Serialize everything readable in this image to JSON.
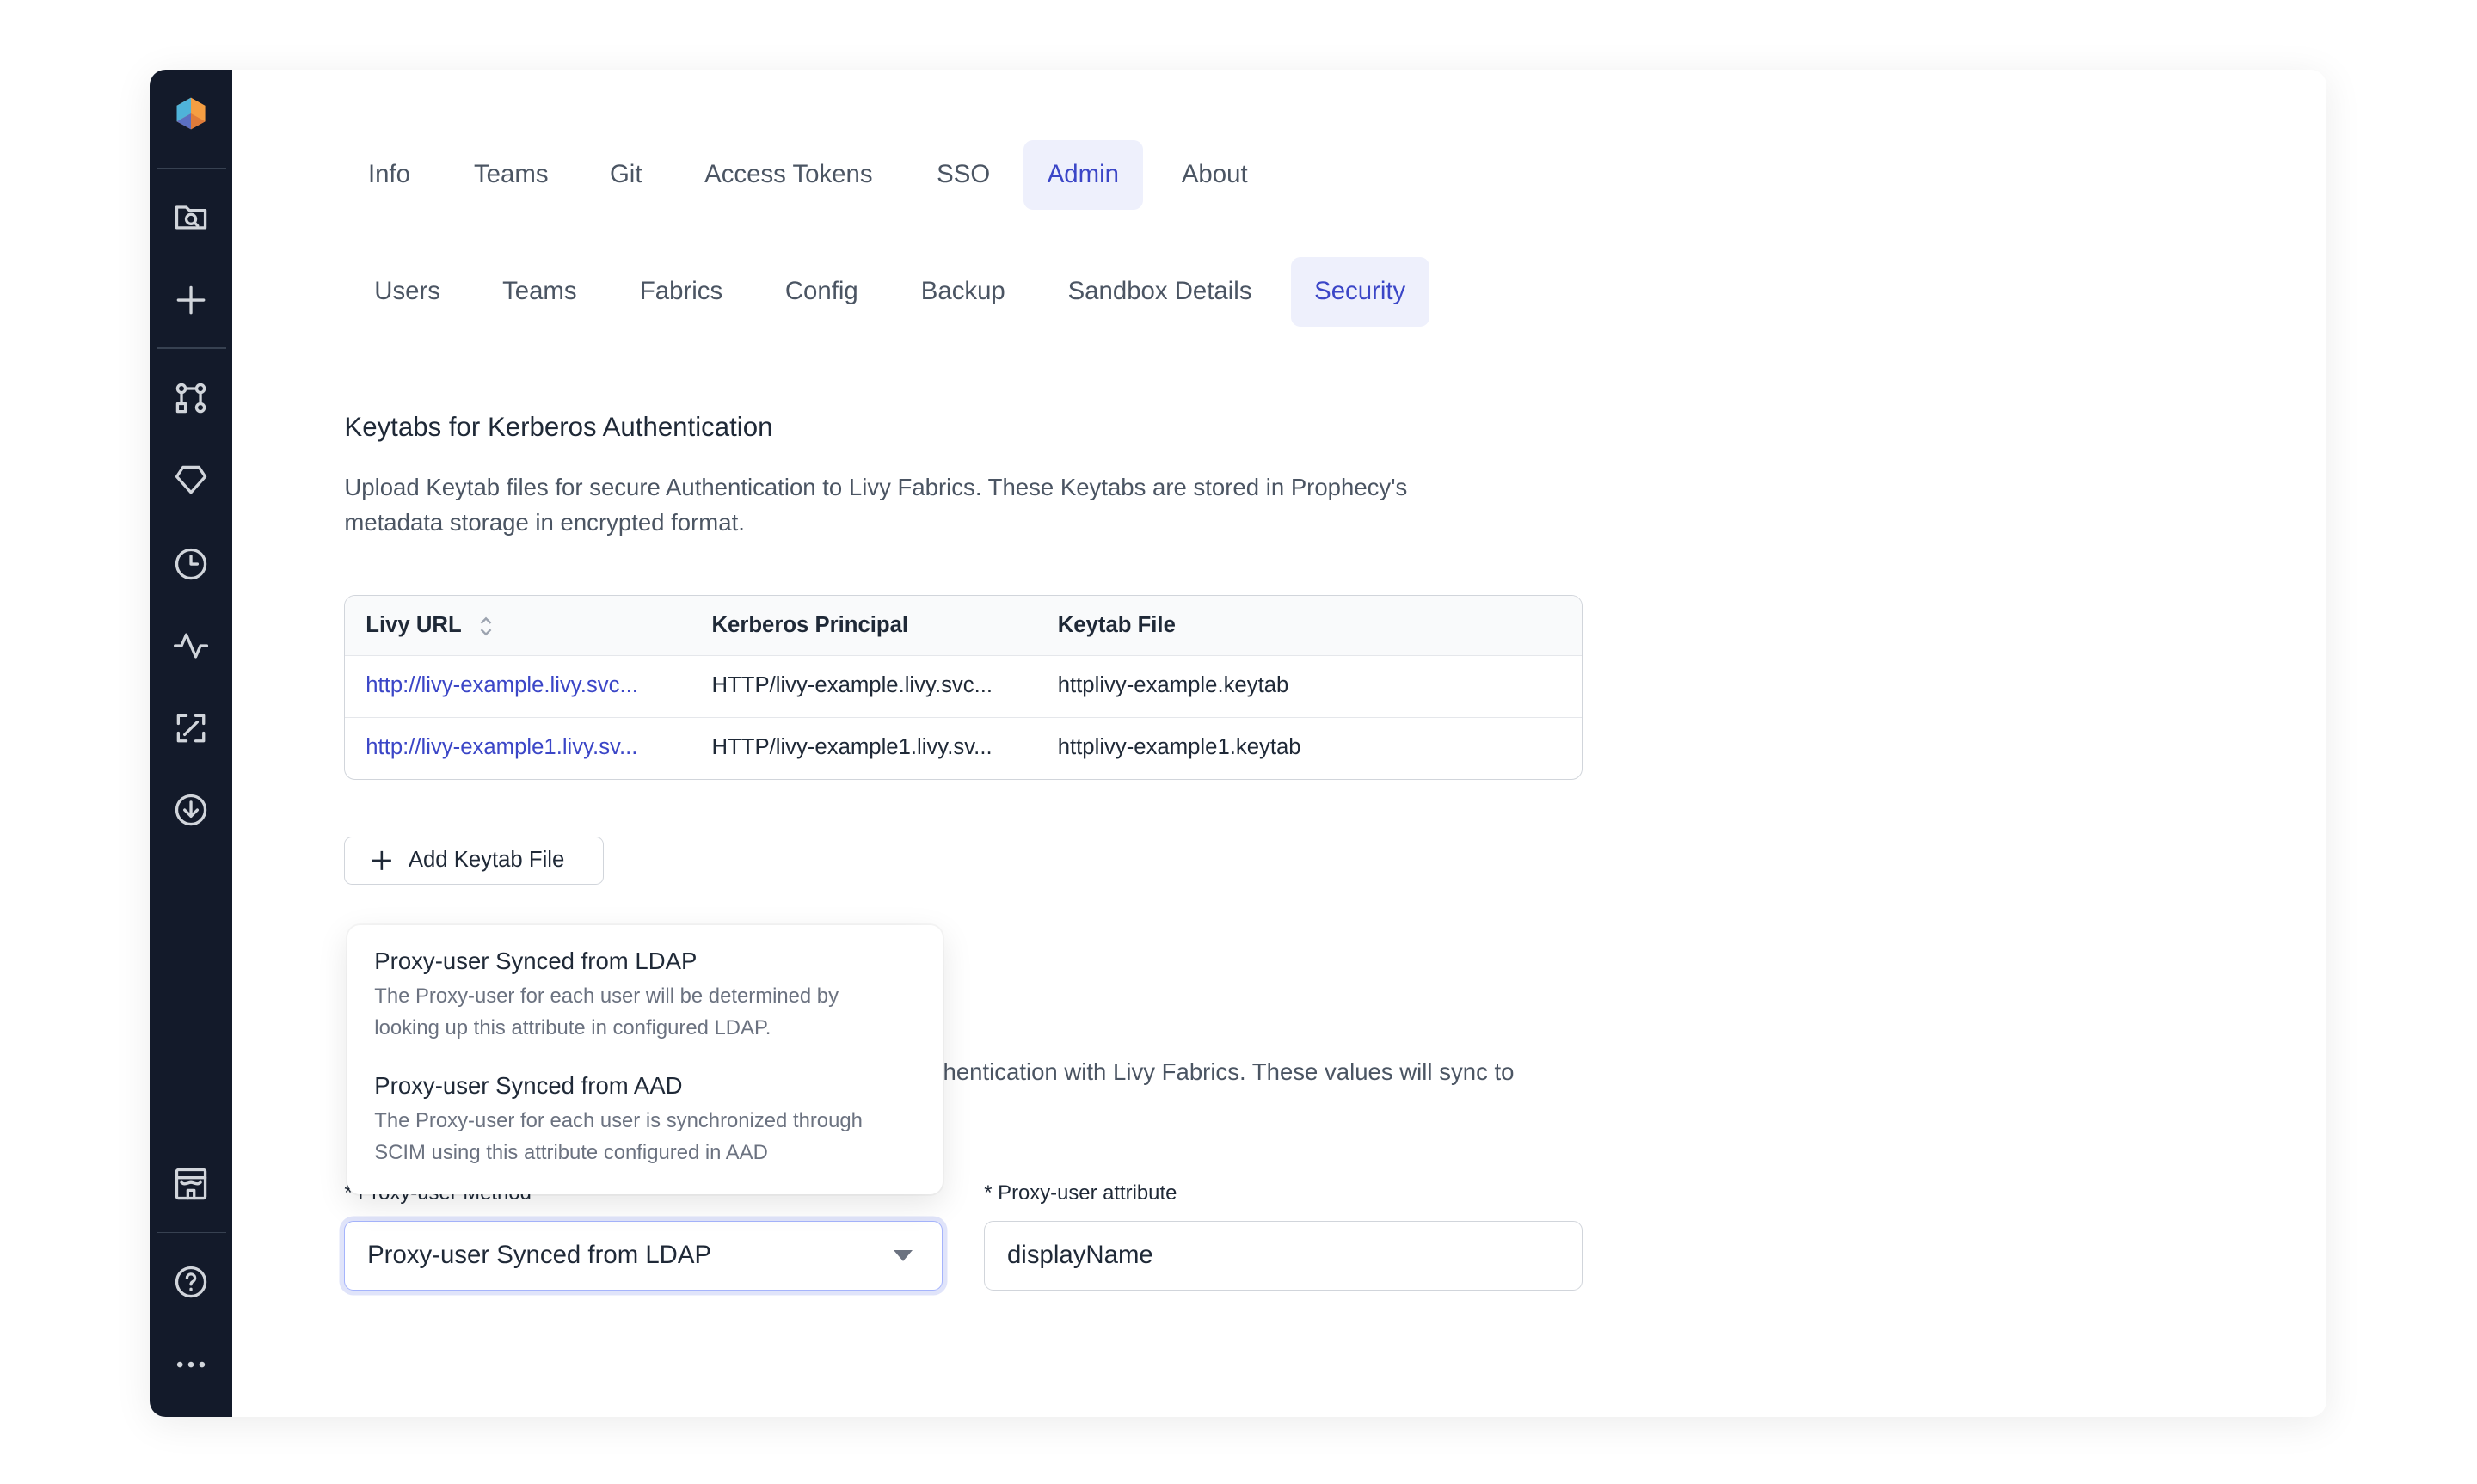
{
  "sidebar": {
    "items": [
      "logo",
      "project-browser",
      "create",
      "pipelines",
      "gems",
      "history",
      "observability",
      "lineage",
      "release",
      "marketplace",
      "help",
      "more"
    ]
  },
  "top_tabs": [
    {
      "label": "Info"
    },
    {
      "label": "Teams"
    },
    {
      "label": "Git"
    },
    {
      "label": "Access Tokens"
    },
    {
      "label": "SSO"
    },
    {
      "label": "Admin",
      "active": true
    },
    {
      "label": "About"
    }
  ],
  "sub_tabs": [
    {
      "label": "Users"
    },
    {
      "label": "Teams"
    },
    {
      "label": "Fabrics"
    },
    {
      "label": "Config"
    },
    {
      "label": "Backup"
    },
    {
      "label": "Sandbox Details"
    },
    {
      "label": "Security",
      "active": true
    }
  ],
  "keytabs": {
    "title": "Keytabs for Kerberos Authentication",
    "description_1": "Upload Keytab files for secure Authentication to Livy Fabrics. These Keytabs are stored in Prophecy's",
    "description_2": "metadata storage in encrypted format.",
    "columns": [
      "Livy URL",
      "Kerberos Principal",
      "Keytab File"
    ],
    "rows": [
      [
        "http://livy-example.livy.svc...",
        "HTTP/livy-example.livy.svc...",
        "httplivy-example.keytab"
      ],
      [
        "http://livy-example1.livy.sv...",
        "HTTP/livy-example1.livy.sv...",
        "httplivy-example1.keytab"
      ]
    ],
    "add_button": "Add Keytab File"
  },
  "proxy": {
    "description_fragment": "hentication with Livy Fabrics. These values will sync to",
    "method_label": "* Proxy-user Method",
    "method_value": "Proxy-user Synced from LDAP",
    "attribute_label": "* Proxy-user attribute",
    "attribute_value": "displayName",
    "options": [
      {
        "title": "Proxy-user Synced from LDAP",
        "desc_1": "The Proxy-user for each user will be determined by",
        "desc_2": "looking up this attribute in configured LDAP."
      },
      {
        "title": "Proxy-user Synced from AAD",
        "desc_1": "The Proxy-user for each user is synchronized through",
        "desc_2": "SCIM using this attribute configured in AAD"
      }
    ]
  },
  "colors": {
    "sidebar": "#131a2a",
    "accent": "#3b46c7",
    "active_tab_bg": "#eef0fc"
  }
}
